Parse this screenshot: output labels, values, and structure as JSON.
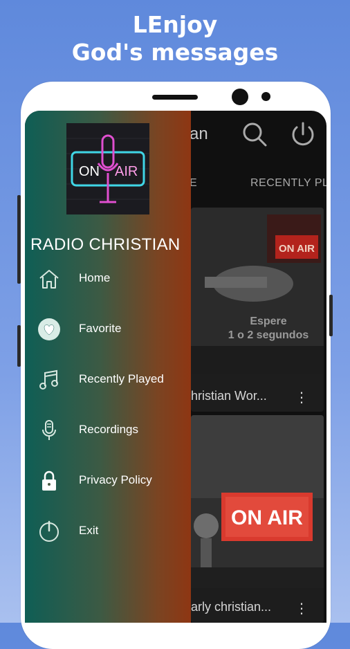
{
  "promo": {
    "line1": "LEnjoy",
    "line2": "God's messages"
  },
  "app_bar": {
    "title_fragment": "an"
  },
  "tabs": [
    {
      "label": "E"
    },
    {
      "label": "RECENTLY PL"
    }
  ],
  "cards": [
    {
      "overlay_text_1": "Espere",
      "overlay_text_2": "1 o 2 segundos",
      "title": "hristian Wor...",
      "more": "⋮"
    },
    {
      "sign_text": "ON AIR",
      "title": "arly christian...",
      "more": "⋮"
    }
  ],
  "drawer": {
    "logo_text_left": "ON",
    "logo_text_right": "AIR",
    "title": "RADIO CHRISTIAN",
    "menu": [
      {
        "label": "Home",
        "icon": "home-icon"
      },
      {
        "label": "Favorite",
        "icon": "heart-icon"
      },
      {
        "label": "Recently Played",
        "icon": "music-note-icon"
      },
      {
        "label": "Recordings",
        "icon": "microphone-icon"
      },
      {
        "label": "Privacy Policy",
        "icon": "lock-icon"
      },
      {
        "label": "Exit",
        "icon": "power-icon"
      }
    ]
  },
  "colors": {
    "background": "#6f93e0",
    "drawer_start": "#0f5e55",
    "drawer_end": "#8e3613",
    "card_sign_red": "#d93a2e"
  }
}
